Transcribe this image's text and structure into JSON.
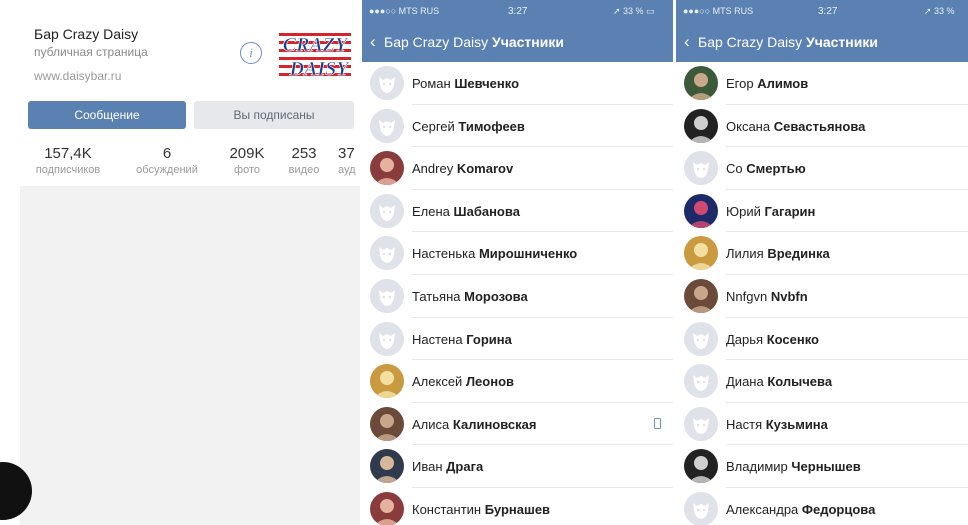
{
  "community": {
    "name": "Бар Crazy Daisy",
    "subtitle": "публичная страница",
    "website": "www.daisybar.ru",
    "info_icon": "info-icon",
    "logo": {
      "line1": "CRAZY",
      "line2": "DAISY",
      "colors": [
        "#1a3f8f",
        "#d8232a"
      ]
    },
    "message_button": "Сообщение",
    "subscribed_button": "Вы подписаны",
    "stats": [
      {
        "value": "157,4K",
        "label": "подписчиков"
      },
      {
        "value": "6",
        "label": "обсуждений"
      },
      {
        "value": "209K",
        "label": "фото"
      },
      {
        "value": "253",
        "label": "видео"
      },
      {
        "value": "37",
        "label": "ауд"
      }
    ]
  },
  "colors": {
    "accent": "#5b81b3",
    "background": "#f2f2f2"
  },
  "screens": [
    {
      "status": {
        "carrier": "●●●○○ MTS RUS",
        "time": "3:27",
        "battery": "33 %"
      },
      "nav": {
        "back": "‹",
        "prefix": "Бар Crazy Daisy",
        "title": "Участники"
      },
      "members": [
        {
          "first": "Роман",
          "last": "Шевченко",
          "avatar": "placeholder"
        },
        {
          "first": "Сергей",
          "last": "Тимофеев",
          "avatar": "placeholder"
        },
        {
          "first": "Andrey",
          "last": "Komarov",
          "avatar": "photo"
        },
        {
          "first": "Елена",
          "last": "Шабанова",
          "avatar": "placeholder"
        },
        {
          "first": "Настенька",
          "last": "Мирошниченко",
          "avatar": "placeholder"
        },
        {
          "first": "Татьяна",
          "last": "Морозова",
          "avatar": "placeholder"
        },
        {
          "first": "Настена",
          "last": "Горина",
          "avatar": "placeholder"
        },
        {
          "first": "Алексей",
          "last": "Леонов",
          "avatar": "photo"
        },
        {
          "first": "Алиса",
          "last": "Калиновская",
          "avatar": "photo",
          "mobile": true
        },
        {
          "first": "Иван",
          "last": "Драга",
          "avatar": "photo"
        },
        {
          "first": "Константин",
          "last": "Бурнашев",
          "avatar": "photo"
        }
      ]
    },
    {
      "status": {
        "carrier": "●●●○○ MTS RUS",
        "time": "3:27",
        "battery": "33 %"
      },
      "nav": {
        "back": "‹",
        "prefix": "Бар Crazy Daisy",
        "title": "Участники"
      },
      "members": [
        {
          "first": "Егор",
          "last": "Алимов",
          "avatar": "photo"
        },
        {
          "first": "Оксана",
          "last": "Севастьянова",
          "avatar": "photo"
        },
        {
          "first": "Со",
          "last": "Смертью",
          "avatar": "placeholder"
        },
        {
          "first": "Юрий",
          "last": "Гагарин",
          "avatar": "photo"
        },
        {
          "first": "Лилия",
          "last": "Врединка",
          "avatar": "photo"
        },
        {
          "first": "Nnfgvn",
          "last": "Nvbfn",
          "avatar": "photo"
        },
        {
          "first": "Дарья",
          "last": "Косенко",
          "avatar": "placeholder"
        },
        {
          "first": "Диана",
          "last": "Колычева",
          "avatar": "placeholder"
        },
        {
          "first": "Настя",
          "last": "Кузьмина",
          "avatar": "placeholder"
        },
        {
          "first": "Владимир",
          "last": "Чернышев",
          "avatar": "photo"
        },
        {
          "first": "Александра",
          "last": "Федорцова",
          "avatar": "placeholder"
        }
      ]
    }
  ]
}
